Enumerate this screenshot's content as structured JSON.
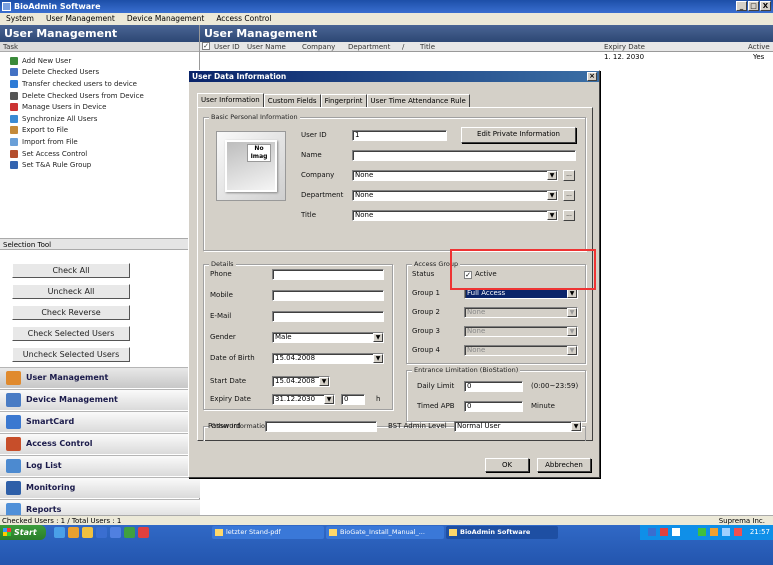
{
  "window": {
    "title": "BioAdmin Software",
    "controls": [
      "_",
      "□",
      "X"
    ]
  },
  "menu": [
    "System",
    "User Management",
    "Device Management",
    "Access Control"
  ],
  "left": {
    "header": "User Management",
    "task_header": "Task",
    "tasks": [
      {
        "label": "Add New User",
        "color": "#3a8a3a"
      },
      {
        "label": "Delete Checked Users",
        "color": "#4472c4"
      },
      {
        "label": "Transfer checked users to device",
        "color": "#2e7bd6"
      },
      {
        "label": "Delete Checked Users from Device",
        "color": "#555555"
      },
      {
        "label": "Manage Users in Device",
        "color": "#cc3333"
      },
      {
        "label": "Synchronize All Users",
        "color": "#3b8bd4"
      },
      {
        "label": "Export to File",
        "color": "#c48a3a"
      },
      {
        "label": "Import from File",
        "color": "#6aa0d8"
      },
      {
        "label": "Set Access Control",
        "color": "#b44e2e"
      },
      {
        "label": "Set T&A Rule Group",
        "color": "#3464b0"
      }
    ],
    "selection_tool": "Selection Tool",
    "sel_buttons": [
      "Check All",
      "Uncheck All",
      "Check Reverse",
      "Check Selected Users",
      "Uncheck Selected Users"
    ],
    "nav": [
      {
        "label": "User Management",
        "color": "#e08a2e"
      },
      {
        "label": "Device Management",
        "color": "#4a7cc4"
      },
      {
        "label": "SmartCard",
        "color": "#3b78d0"
      },
      {
        "label": "Access Control",
        "color": "#c74e2a"
      },
      {
        "label": "Log List",
        "color": "#4c8ad0"
      },
      {
        "label": "Monitoring",
        "color": "#2e5fa8"
      },
      {
        "label": "Reports",
        "color": "#5090d8"
      }
    ]
  },
  "right": {
    "header": "User Management",
    "columns": [
      "User ID",
      "User Name",
      "Company",
      "Department",
      "/",
      "Title",
      "Expiry Date",
      "Active"
    ],
    "row": {
      "expiry": "1. 12. 2030",
      "active": "Yes"
    }
  },
  "status": {
    "left": "Checked Users : 1 / Total Users : 1",
    "right": "Suprema Inc."
  },
  "taskbar": {
    "start": "Start",
    "tasks": [
      "letzter Stand-pdf",
      "BioGate_Install_Manual_...",
      "BioAdmin Software"
    ],
    "clock": "21:57"
  },
  "dialog": {
    "title": "User Data Information",
    "tabs": [
      "User Information",
      "Custom Fields",
      "Fingerprint",
      "User Time Attendance Rule"
    ],
    "basic": {
      "title": "Basic Personal Information",
      "photo_tag": "No Imag",
      "user_id_label": "User ID",
      "user_id": "1",
      "edit_private": "Edit Private Information",
      "name_label": "Name",
      "name": "",
      "company_label": "Company",
      "company": "None",
      "department_label": "Department",
      "department": "None",
      "title_label": "Title",
      "title_value": "None"
    },
    "details": {
      "title": "Details",
      "phone_label": "Phone",
      "mobile_label": "Mobile",
      "email_label": "E-Mail",
      "gender_label": "Gender",
      "gender": "Male",
      "dob_label": "Date of Birth",
      "dob": "15.04.2008",
      "start_label": "Start Date",
      "start": "15.04.2008",
      "expiry_label": "Expiry Date",
      "expiry": "31.12.2030",
      "expiry_h": "0",
      "h": "h"
    },
    "access": {
      "title": "Access Group",
      "status_label": "Status",
      "active": "Active",
      "g1_label": "Group 1",
      "g1": "Full Access",
      "g2_label": "Group 2",
      "g2": "None",
      "g3_label": "Group 3",
      "g3": "None",
      "g4_label": "Group 4",
      "g4": "None"
    },
    "entrance": {
      "title": "Entrance Limitation (BioStation)",
      "daily_label": "Daily Limit",
      "daily": "0",
      "daily_range": "(0:00~23:59)",
      "apb_label": "Timed APB",
      "apb": "0",
      "apb_unit": "Minute"
    },
    "other": {
      "title": "Other Information",
      "password_label": "Password",
      "bst_label": "BST Admin Level",
      "bst": "Normal User"
    },
    "ok": "OK",
    "cancel": "Abbrechen"
  }
}
